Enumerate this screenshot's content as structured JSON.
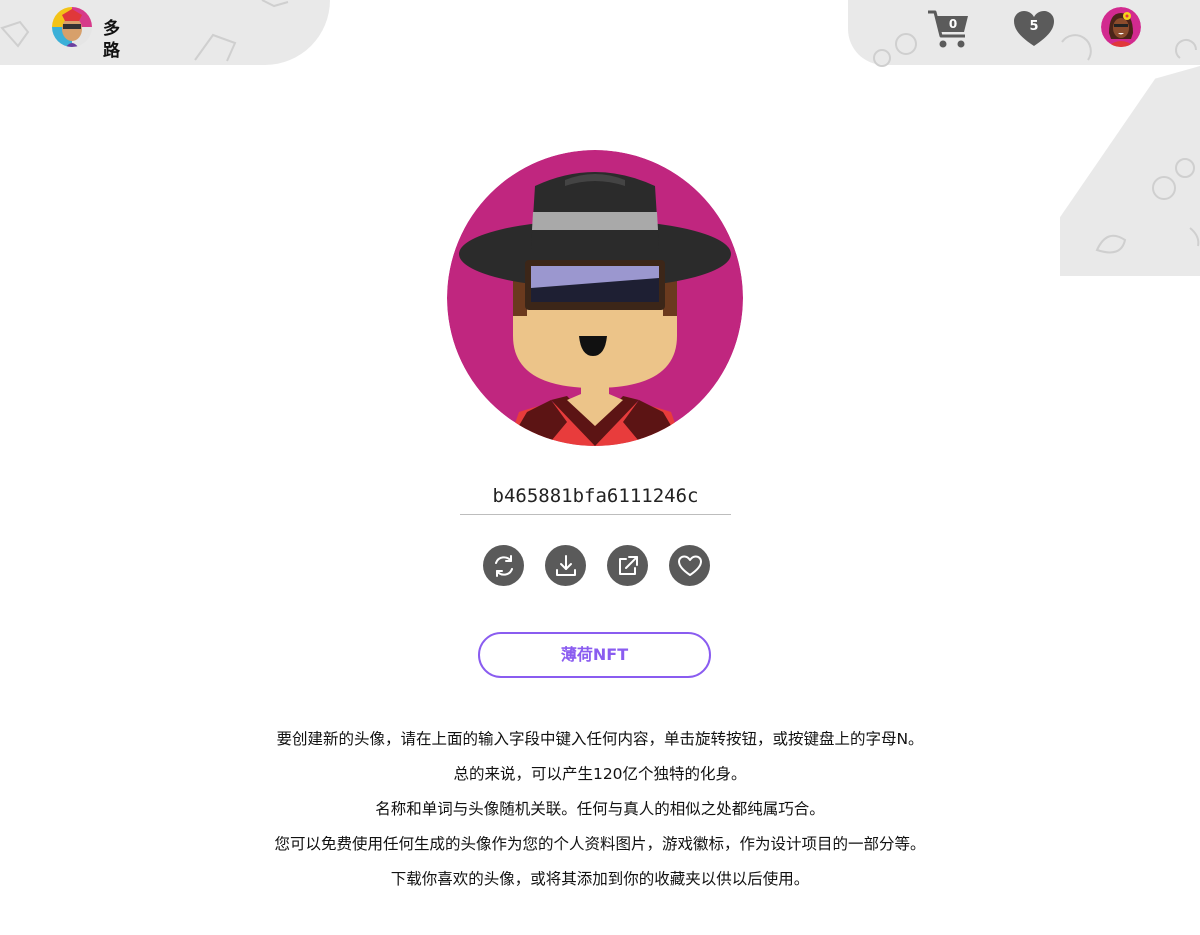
{
  "header": {
    "brand_name": "多路",
    "logo_icon": "multi-avatar-logo-icon",
    "cart_count": "0",
    "favorites_count": "5",
    "cart_icon": "cart-icon",
    "favorites_icon": "heart-icon",
    "user_avatar_icon": "user-avatar-icon"
  },
  "avatar": {
    "main_icon": "generated-avatar-hat-glasses",
    "colors": {
      "background": "#c0267f",
      "hat": "#2b2b2b",
      "hat_band": "#a9a9a9",
      "glasses_lens": "#9b97cf",
      "skin": "#ecc489",
      "shirt": "#e83c3c"
    }
  },
  "seed": {
    "value": "b465881bfa6111246c"
  },
  "actions": [
    {
      "name": "refresh",
      "icon": "refresh-icon"
    },
    {
      "name": "download",
      "icon": "download-icon"
    },
    {
      "name": "open-external",
      "icon": "external-link-icon"
    },
    {
      "name": "favorite",
      "icon": "heart-outline-icon"
    }
  ],
  "nft_button": {
    "label": "薄荷NFT",
    "color": "#8a5cf0"
  },
  "description": [
    "要创建新的头像，请在上面的输入字段中键入任何内容，单击旋转按钮，或按键盘上的字母N。",
    "总的来说，可以产生120亿个独特的化身。",
    "名称和单词与头像随机关联。任何与真人的相似之处都纯属巧合。",
    "您可以免费使用任何生成的头像作为您的个人资料图片，游戏徽标，作为设计项目的一部分等。",
    "下载你喜欢的头像，或将其添加到你的收藏夹以供以后使用。"
  ]
}
